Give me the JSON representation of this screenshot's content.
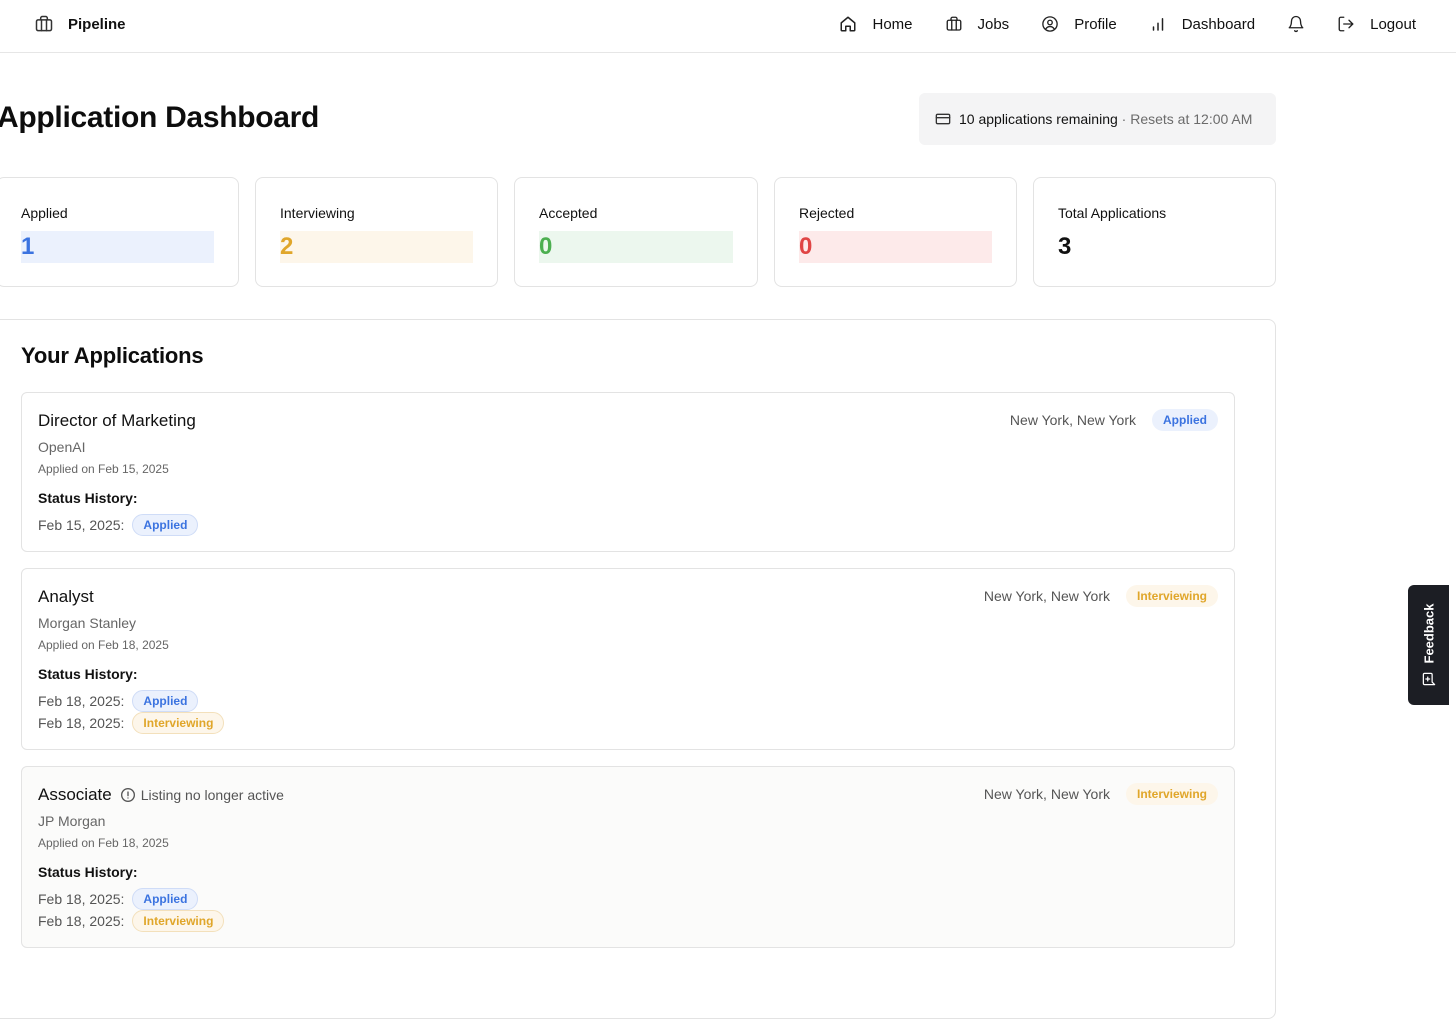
{
  "brand": {
    "name": "Pipeline",
    "icon": "briefcase-icon"
  },
  "nav": {
    "items": [
      {
        "label": "Home",
        "icon": "home-icon"
      },
      {
        "label": "Jobs",
        "icon": "briefcase-icon"
      },
      {
        "label": "Profile",
        "icon": "user-circle-icon"
      },
      {
        "label": "Dashboard",
        "icon": "bar-chart-icon"
      },
      {
        "label": "",
        "icon": "bell-icon"
      },
      {
        "label": "Logout",
        "icon": "logout-icon"
      }
    ]
  },
  "header": {
    "title": "Application Dashboard",
    "quota_main": "10 applications remaining",
    "quota_sep": " · ",
    "quota_reset": "Resets at 12:00 AM",
    "quota_icon": "credit-card-icon"
  },
  "stats": [
    {
      "label": "Applied",
      "value": "1",
      "color": "#3b73e0"
    },
    {
      "label": "Interviewing",
      "value": "2",
      "color": "#e0a62a"
    },
    {
      "label": "Accepted",
      "value": "0",
      "color": "#4caf50"
    },
    {
      "label": "Rejected",
      "value": "0",
      "color": "#e04545"
    },
    {
      "label": "Total Applications",
      "value": "3",
      "color": "#111111"
    }
  ],
  "applications_title": "Your Applications",
  "status_history_label": "Status History:",
  "applications": [
    {
      "title": "Director of Marketing",
      "company": "OpenAI",
      "applied_on": "Applied on Feb 15, 2025",
      "location": "New York, New York",
      "status": "Applied",
      "history": [
        {
          "date": "Feb 15, 2025:",
          "status": "Applied"
        }
      ]
    },
    {
      "title": "Analyst",
      "company": "Morgan Stanley",
      "applied_on": "Applied on Feb 18, 2025",
      "location": "New York, New York",
      "status": "Interviewing",
      "history": [
        {
          "date": "Feb 18, 2025:",
          "status": "Applied"
        },
        {
          "date": "Feb 18, 2025:",
          "status": "Interviewing"
        }
      ]
    },
    {
      "title": "Associate",
      "inactive_note": "Listing no longer active",
      "company": "JP Morgan",
      "applied_on": "Applied on Feb 18, 2025",
      "location": "New York, New York",
      "status": "Interviewing",
      "history": [
        {
          "date": "Feb 18, 2025:",
          "status": "Applied"
        },
        {
          "date": "Feb 18, 2025:",
          "status": "Interviewing"
        }
      ]
    }
  ],
  "feedback": {
    "label": "Feedback",
    "icon": "message-square-icon"
  },
  "colors": {
    "applied": "#3b73e0",
    "interviewing": "#e0a62a",
    "accepted": "#4caf50",
    "rejected": "#e04545"
  }
}
